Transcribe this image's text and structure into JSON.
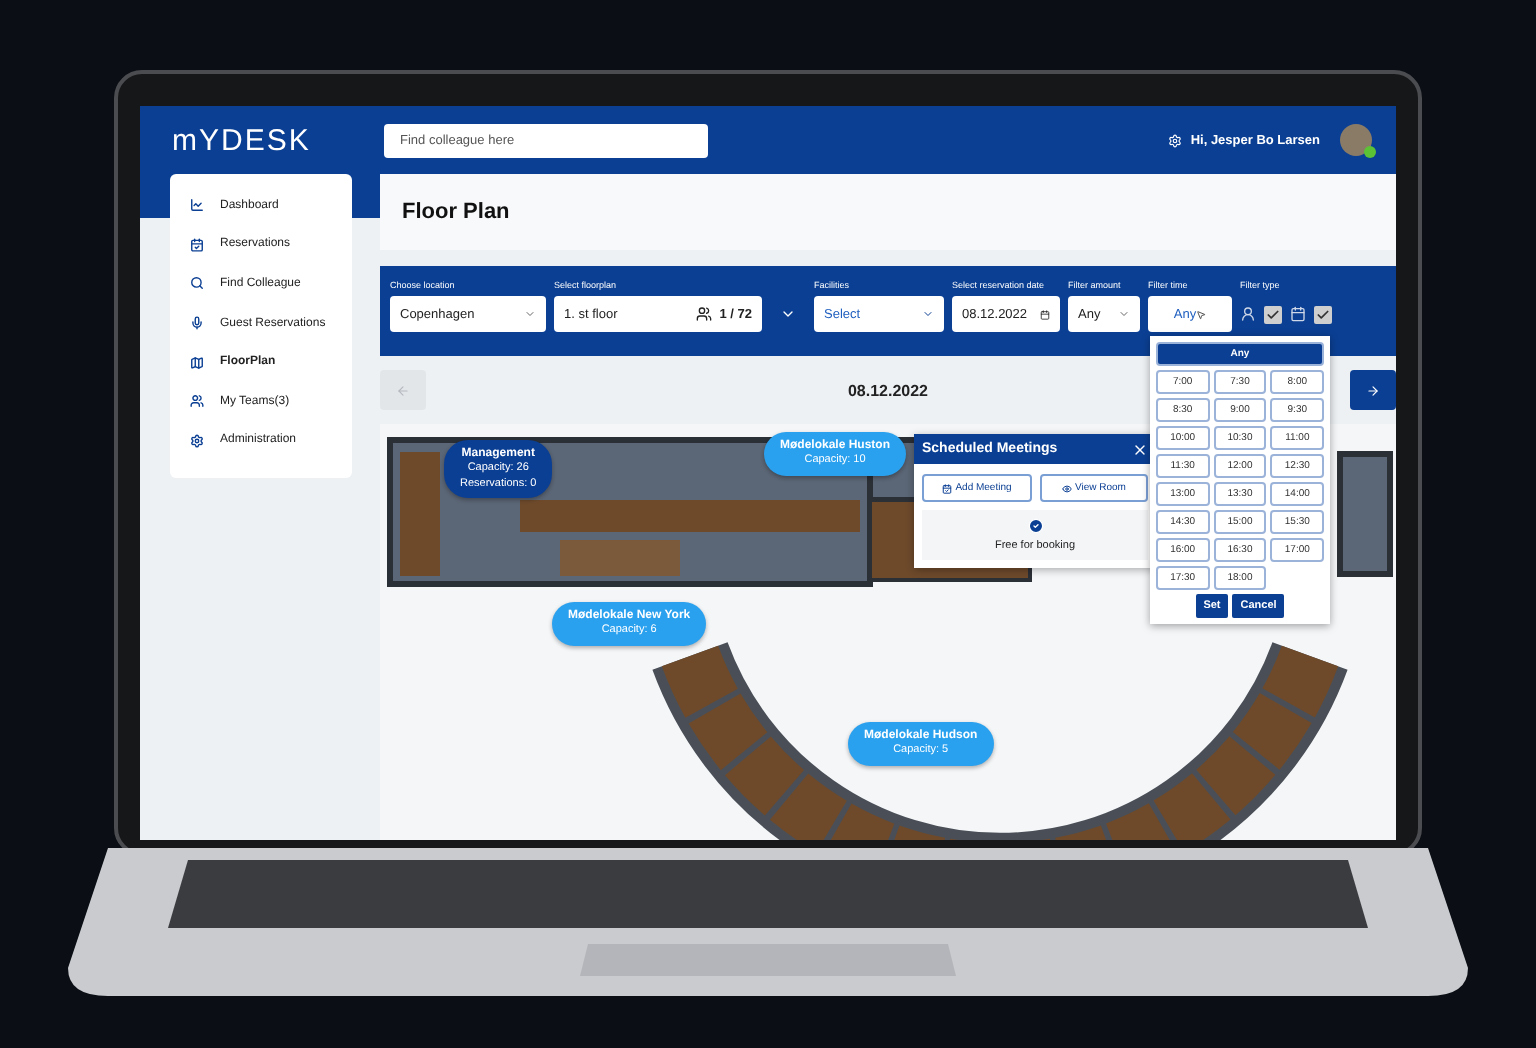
{
  "header": {
    "logo": "mYDESK",
    "search": {
      "placeholder": "Find colleague here"
    },
    "greeting": "Hi, Jesper Bo Larsen"
  },
  "sidebar": {
    "items": [
      {
        "label": "Dashboard",
        "selected": false
      },
      {
        "label": "Reservations",
        "selected": false
      },
      {
        "label": "Find Colleague",
        "selected": false
      },
      {
        "label": "Guest Reservations",
        "selected": false
      },
      {
        "label": "FloorPlan",
        "selected": true
      },
      {
        "label": "My Teams(3)",
        "selected": false
      },
      {
        "label": "Administration",
        "selected": false
      }
    ]
  },
  "page_title": "Floor Plan",
  "filters": [
    {
      "kind": "select",
      "label": "Choose location",
      "value": "Copenhagen"
    },
    {
      "kind": "floorplan",
      "label": "Select floorplan",
      "value": "1. st floor",
      "count": "1 / 72"
    },
    {
      "kind": "select",
      "label": "Facilities",
      "placeholder": "Select"
    },
    {
      "kind": "date",
      "label": "Select reservation date",
      "value": "08.12.2022"
    },
    {
      "kind": "select",
      "label": "Filter amount",
      "value": "Any"
    },
    {
      "kind": "time",
      "label": "Filter time",
      "value": "Any"
    },
    {
      "kind": "types",
      "label": "Filter type",
      "types": [
        {
          "kind": "guest",
          "checked": true
        },
        {
          "kind": "meeting",
          "checked": true
        }
      ]
    }
  ],
  "date_nav": {
    "date": "08.12.2022",
    "prev_disabled": true
  },
  "time_picker": {
    "options": [
      {
        "label": "Any",
        "kind": "all",
        "selected": true
      },
      {
        "label": "7:00",
        "kind": "slot",
        "selected": false
      },
      {
        "label": "7:30",
        "kind": "slot",
        "selected": false
      },
      {
        "label": "8:00",
        "kind": "slot",
        "selected": false
      },
      {
        "label": "8:30",
        "kind": "slot",
        "selected": false
      },
      {
        "label": "9:00",
        "kind": "slot",
        "selected": false
      },
      {
        "label": "9:30",
        "kind": "slot",
        "selected": false
      },
      {
        "label": "10:00",
        "kind": "slot",
        "selected": false
      },
      {
        "label": "10:30",
        "kind": "slot",
        "selected": false
      },
      {
        "label": "11:00",
        "kind": "slot",
        "selected": false
      },
      {
        "label": "11:30",
        "kind": "slot",
        "selected": false
      },
      {
        "label": "12:00",
        "kind": "slot",
        "selected": false
      },
      {
        "label": "12:30",
        "kind": "slot",
        "selected": false
      },
      {
        "label": "13:00",
        "kind": "slot",
        "selected": false
      },
      {
        "label": "13:30",
        "kind": "slot",
        "selected": false
      },
      {
        "label": "14:00",
        "kind": "slot",
        "selected": false
      },
      {
        "label": "14:30",
        "kind": "slot",
        "selected": false
      },
      {
        "label": "15:00",
        "kind": "slot",
        "selected": false
      },
      {
        "label": "15:30",
        "kind": "slot",
        "selected": false
      },
      {
        "label": "16:00",
        "kind": "slot",
        "selected": false
      },
      {
        "label": "16:30",
        "kind": "slot",
        "selected": false
      },
      {
        "label": "17:00",
        "kind": "slot",
        "selected": false
      },
      {
        "label": "17:30",
        "kind": "slot",
        "selected": false
      },
      {
        "label": "18:00",
        "kind": "slot",
        "selected": false
      }
    ],
    "set": "Set",
    "cancel": "Cancel"
  },
  "rooms": [
    {
      "kind": "highlighted",
      "lines": [
        "Management",
        "Capacity: 26",
        "Reservations: 0"
      ]
    },
    {
      "kind": "room",
      "lines": [
        "Mødelokale Huston",
        "Capacity: 10"
      ]
    },
    {
      "kind": "room",
      "lines": [
        "Mødelokale New York",
        "Capacity: 6"
      ]
    },
    {
      "kind": "room",
      "lines": [
        "Mødelokale Hudson",
        "Capacity: 5"
      ]
    }
  ],
  "popup": {
    "title": "Scheduled Meetings",
    "buttons": [
      {
        "label": "Add Meeting",
        "kind": "add"
      },
      {
        "label": "View Room",
        "kind": "view"
      }
    ],
    "status": "Free for booking"
  }
}
